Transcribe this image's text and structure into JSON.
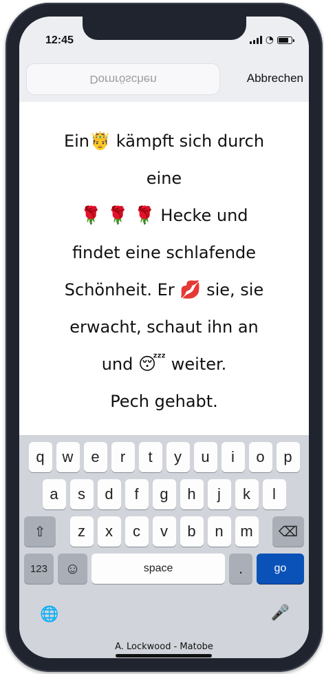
{
  "status_bar": {
    "time": "12:45"
  },
  "search": {
    "value": "Dornröschen",
    "cancel_label": "Abbrechen"
  },
  "message": {
    "line1": "Ein",
    "line1_emoji": "🤴",
    "line1_after": "kämpft sich durch",
    "line2": "eine",
    "line3_emoji": "🌹 🌹 🌹",
    "line3_after": "Hecke und",
    "line4": "findet eine schlafende",
    "line5_before": "Schönheit. Er",
    "line5_emoji": "💋",
    "line5_after": "sie, sie",
    "line6": "erwacht, schaut ihn an",
    "line7_before": "und",
    "line7_emoji": "😴",
    "line7_after": "weiter.",
    "line8": "Pech gehabt."
  },
  "keyboard": {
    "row1": [
      "q",
      "w",
      "e",
      "r",
      "t",
      "y",
      "u",
      "i",
      "o",
      "p"
    ],
    "row2": [
      "a",
      "s",
      "d",
      "f",
      "g",
      "h",
      "j",
      "k",
      "l"
    ],
    "row3": [
      "z",
      "x",
      "c",
      "v",
      "b",
      "n",
      "m"
    ],
    "num_label": "123",
    "space_label": "space",
    "period_label": ".",
    "go_label": "go"
  },
  "credit": "A. Lockwood - Matobe",
  "colors": {
    "go_key": "#0b52b8",
    "keyboard_bg": "#d1d4da",
    "phone_frame": "#20242e"
  },
  "icons": [
    "shift-icon",
    "backspace-icon",
    "emoji-icon",
    "globe-icon",
    "microphone-icon",
    "wifi-icon",
    "battery-icon",
    "signal-icon"
  ]
}
